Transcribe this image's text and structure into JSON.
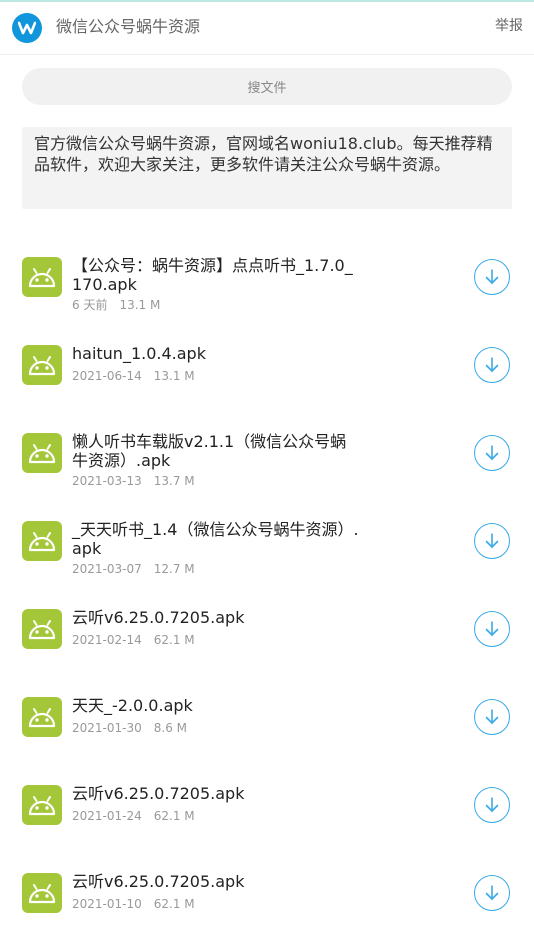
{
  "header": {
    "logo_letter": "w",
    "title": "微信公众号蜗牛资源",
    "report_label": "举报"
  },
  "search": {
    "label": "搜文件"
  },
  "notice": {
    "text": "官方微信公众号蜗牛资源，官网域名woniu18.club。每天推荐精品软件，欢迎大家关注，更多软件请关注公众号蜗牛资源。"
  },
  "files": [
    {
      "name": "【公众号：蜗牛资源】点点听书_1.7.0_170.apk",
      "date": "6 天前",
      "size": "13.1 M",
      "icon": "android-icon"
    },
    {
      "name": "haitun_1.0.4.apk",
      "date": "2021-06-14",
      "size": "13.1 M",
      "icon": "android-icon"
    },
    {
      "name": "懒人听书车载版v2.1.1（微信公众号蜗牛资源）.apk",
      "date": "2021-03-13",
      "size": "13.7 M",
      "icon": "android-icon"
    },
    {
      "name": "_天天听书_1.4（微信公众号蜗牛资源）.apk",
      "date": "2021-03-07",
      "size": "12.7 M",
      "icon": "android-icon"
    },
    {
      "name": "云听v6.25.0.7205.apk",
      "date": "2021-02-14",
      "size": "62.1 M",
      "icon": "android-icon"
    },
    {
      "name": "天天_-2.0.0.apk",
      "date": "2021-01-30",
      "size": "8.6 M",
      "icon": "android-icon"
    },
    {
      "name": "云听v6.25.0.7205.apk",
      "date": "2021-01-24",
      "size": "62.1 M",
      "icon": "android-icon"
    },
    {
      "name": "云听v6.25.0.7205.apk",
      "date": "2021-01-10",
      "size": "62.1 M",
      "icon": "android-icon"
    }
  ],
  "colors": {
    "accent": "#3aa9ea",
    "android_green": "#a4c639",
    "logo_blue": "#1296db"
  }
}
